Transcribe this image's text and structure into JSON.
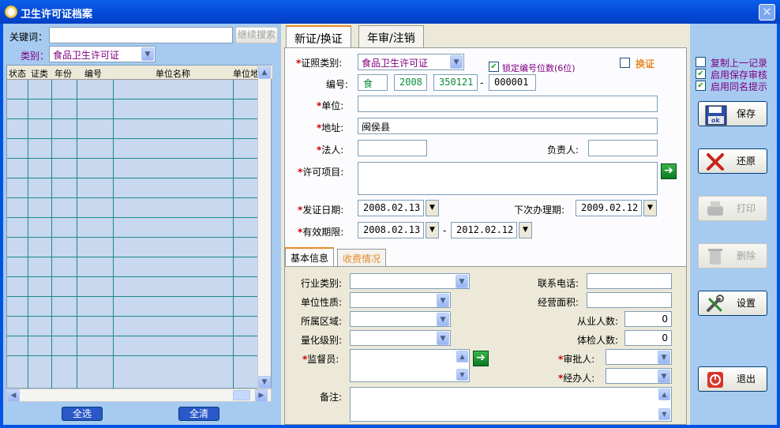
{
  "window": {
    "title": "卫生许可证档案",
    "close_glyph": "✕"
  },
  "search": {
    "keyword_label": "关键词：",
    "keyword_value": "",
    "continue_label": "继续搜索",
    "category_label": "类别：",
    "category_value": "食品卫生许可证"
  },
  "grid": {
    "columns": [
      "状态",
      "证类",
      "年份",
      "编号",
      "单位名称",
      "单位地址"
    ],
    "select_all": "全选",
    "clear_all": "全清"
  },
  "tabs": [
    "新证/换证",
    "年审/注销"
  ],
  "form": {
    "cert_type_label": "证照类别:",
    "cert_type_value": "食品卫生许可证",
    "lock_label": "锁定编号位数(6位)",
    "lock_checked": true,
    "renew_label": "换证",
    "renew_checked": false,
    "number_label": "编号:",
    "number_prefix": "食",
    "number_year": "2008",
    "number_area": "350121",
    "number_dash": "-",
    "number_seq": "000001",
    "unit_label": "单位:",
    "unit_value": "",
    "address_label": "地址:",
    "address_value": "闽侯县",
    "legal_label": "法人:",
    "legal_value": "",
    "charge_label": "负责人:",
    "charge_value": "",
    "items_label": "许可项目:",
    "items_value": "",
    "issue_label": "发证日期:",
    "issue_value": "2008.02.13",
    "next_label": "下次办理期:",
    "next_value": "2009.02.12",
    "valid_label": "有效期限:",
    "valid_from": "2008.02.13",
    "valid_sep": "-",
    "valid_to": "2012.02.12"
  },
  "subtabs": [
    "基本信息",
    "收费情况"
  ],
  "basic": {
    "industry_label": "行业类别:",
    "phone_label": "联系电话:",
    "nature_label": "单位性质:",
    "area_label": "经营面积:",
    "region_label": "所属区域:",
    "staff_label": "从业人数:",
    "staff_value": "0",
    "level_label": "量化级别:",
    "checked_label": "体检人数:",
    "checked_value": "0",
    "supervisor_label": "监督员:",
    "approver_label": "审批人:",
    "handler_label": "经办人:",
    "remark_label": "备注:"
  },
  "options": {
    "copy_last": "复制上一记录",
    "copy_last_checked": false,
    "save_audit": "启用保存审核",
    "save_audit_checked": true,
    "same_name": "启用同名提示",
    "same_name_checked": true
  },
  "actions": {
    "save": "保存",
    "restore": "还原",
    "print": "打印",
    "delete": "删除",
    "settings": "设置",
    "exit": "退出"
  },
  "colors": {
    "window_blue": "#0054e3",
    "panel_blue": "#a6caf0",
    "tab_accent": "#e68b2c",
    "required": "#cc0000",
    "go_green": "#0a7a24"
  }
}
